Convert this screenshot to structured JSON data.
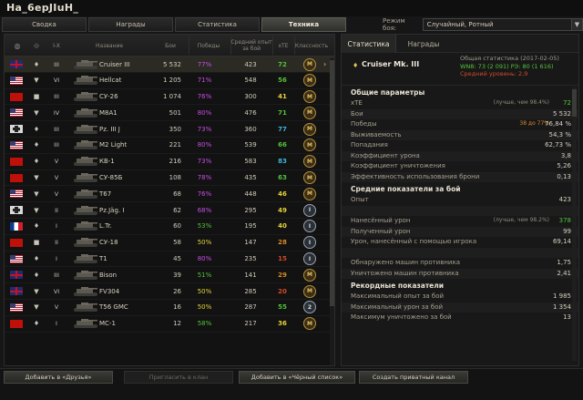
{
  "title": "Ha_6epJIuH_",
  "tabs": [
    {
      "label": "Сводка"
    },
    {
      "label": "Награды"
    },
    {
      "label": "Статистика"
    },
    {
      "label": "Техника"
    }
  ],
  "mode": {
    "label": "Режим боя:",
    "value": "Случайный, Ротный"
  },
  "columns": {
    "nation": "",
    "class": "",
    "tier": "I-X",
    "name": "Название",
    "battles": "Бои",
    "wins": "Победы",
    "avg_exp": "Средний опыт за бой",
    "xte": "xTE",
    "mastery": "Классность"
  },
  "vehicles": [
    {
      "nation": "gb",
      "class": "♦",
      "tier": "III",
      "name": "Cruiser III",
      "battles": "5 532",
      "wins": "77%",
      "win_color": "#c84ee8",
      "exp": "423",
      "xte": "72",
      "xte_color": "#53c23a",
      "mastery": "M",
      "mastery_color": "#e3c267"
    },
    {
      "nation": "us",
      "class": "▼",
      "tier": "VI",
      "name": "Hellcat",
      "battles": "1 205",
      "wins": "71%",
      "win_color": "#c84ee8",
      "exp": "548",
      "xte": "56",
      "xte_color": "#53c23a",
      "mastery": "M",
      "mastery_color": "#e3c267"
    },
    {
      "nation": "su",
      "class": "■",
      "tier": "III",
      "name": "СУ-26",
      "battles": "1 074",
      "wins": "76%",
      "win_color": "#c84ee8",
      "exp": "300",
      "xte": "41",
      "xte_color": "#e6d43a",
      "mastery": "M",
      "mastery_color": "#e3c267"
    },
    {
      "nation": "us",
      "class": "▼",
      "tier": "IV",
      "name": "M8A1",
      "battles": "501",
      "wins": "80%",
      "win_color": "#c84ee8",
      "exp": "476",
      "xte": "71",
      "xte_color": "#53c23a",
      "mastery": "M",
      "mastery_color": "#e3c267"
    },
    {
      "nation": "de",
      "class": "♦",
      "tier": "III",
      "name": "Pz. III J",
      "battles": "350",
      "wins": "73%",
      "win_color": "#c84ee8",
      "exp": "360",
      "xte": "77",
      "xte_color": "#3fb7d8",
      "mastery": "M",
      "mastery_color": "#e3c267"
    },
    {
      "nation": "us",
      "class": "♦",
      "tier": "III",
      "name": "M2 Light",
      "battles": "221",
      "wins": "80%",
      "win_color": "#c84ee8",
      "exp": "539",
      "xte": "66",
      "xte_color": "#53c23a",
      "mastery": "M",
      "mastery_color": "#e3c267"
    },
    {
      "nation": "su",
      "class": "♦",
      "tier": "V",
      "name": "КВ-1",
      "battles": "216",
      "wins": "73%",
      "win_color": "#c84ee8",
      "exp": "583",
      "xte": "83",
      "xte_color": "#3fb7d8",
      "mastery": "M",
      "mastery_color": "#e3c267"
    },
    {
      "nation": "su",
      "class": "▼",
      "tier": "V",
      "name": "СУ-85Б",
      "battles": "108",
      "wins": "78%",
      "win_color": "#c84ee8",
      "exp": "435",
      "xte": "63",
      "xte_color": "#53c23a",
      "mastery": "M",
      "mastery_color": "#e3c267"
    },
    {
      "nation": "us",
      "class": "▼",
      "tier": "V",
      "name": "T67",
      "battles": "68",
      "wins": "76%",
      "win_color": "#c84ee8",
      "exp": "448",
      "xte": "46",
      "xte_color": "#e6d43a",
      "mastery": "M",
      "mastery_color": "#e3c267"
    },
    {
      "nation": "de",
      "class": "▼",
      "tier": "II",
      "name": "Pz.Jäg. I",
      "battles": "62",
      "wins": "68%",
      "win_color": "#c84ee8",
      "exp": "295",
      "xte": "49",
      "xte_color": "#e6d43a",
      "mastery": "I",
      "mastery_color": "#d7dde5"
    },
    {
      "nation": "fr",
      "class": "♦",
      "tier": "I",
      "name": "L.Tr.",
      "battles": "60",
      "wins": "53%",
      "win_color": "#53c23a",
      "exp": "195",
      "xte": "40",
      "xte_color": "#e6d43a",
      "mastery": "I",
      "mastery_color": "#d7dde5"
    },
    {
      "nation": "su",
      "class": "■",
      "tier": "II",
      "name": "СУ-18",
      "battles": "58",
      "wins": "50%",
      "win_color": "#e6d43a",
      "exp": "147",
      "xte": "28",
      "xte_color": "#d68a2a",
      "mastery": "I",
      "mastery_color": "#d7dde5"
    },
    {
      "nation": "us",
      "class": "♦",
      "tier": "I",
      "name": "T1",
      "battles": "45",
      "wins": "80%",
      "win_color": "#c84ee8",
      "exp": "235",
      "xte": "15",
      "xte_color": "#d04a2a",
      "mastery": "I",
      "mastery_color": "#d7dde5"
    },
    {
      "nation": "gb",
      "class": "♦",
      "tier": "III",
      "name": "Bison",
      "battles": "39",
      "wins": "51%",
      "win_color": "#53c23a",
      "exp": "141",
      "xte": "29",
      "xte_color": "#d68a2a",
      "mastery": "M",
      "mastery_color": "#e3c267"
    },
    {
      "nation": "gb",
      "class": "▼",
      "tier": "VI",
      "name": "FV304",
      "battles": "26",
      "wins": "50%",
      "win_color": "#e6d43a",
      "exp": "285",
      "xte": "20",
      "xte_color": "#d04a2a",
      "mastery": "M",
      "mastery_color": "#e3c267"
    },
    {
      "nation": "us",
      "class": "▼",
      "tier": "V",
      "name": "T56 GMC",
      "battles": "16",
      "wins": "50%",
      "win_color": "#e6d43a",
      "exp": "287",
      "xte": "55",
      "xte_color": "#53c23a",
      "mastery": "2",
      "mastery_color": "#d7dde5"
    },
    {
      "nation": "su",
      "class": "♦",
      "tier": "I",
      "name": "МС-1",
      "battles": "12",
      "wins": "58%",
      "win_color": "#53c23a",
      "exp": "217",
      "xte": "36",
      "xte_color": "#e6d43a",
      "mastery": "M",
      "mastery_color": "#e3c267"
    }
  ],
  "detail": {
    "tabs": [
      {
        "label": "Статистика"
      },
      {
        "label": "Награды"
      }
    ],
    "vehicle_name": "Cruiser Mk. III",
    "info_line1": "Общая статистика (2017-02-05)",
    "info_line2": "WN8: 73 (2 091) РЭ: 80 (1 616)",
    "info_line3": "Средний уровень: 2,9",
    "sections": [
      {
        "title": "Общие параметры",
        "rows": [
          {
            "k": "xTE",
            "note": "(лучше, чем 98.4%)",
            "v": "72",
            "v_color": "#53c23a"
          },
          {
            "k": "Бои",
            "note": "",
            "v": "5 532",
            "v_color": "#d4cebe"
          },
          {
            "k": "Победы",
            "note": "38 до 77%",
            "v": "76,84 %",
            "v_color": "#d4cebe"
          },
          {
            "k": "Выживаемость",
            "note": "",
            "v": "54,3 %",
            "v_color": "#d4cebe"
          },
          {
            "k": "Попадания",
            "note": "",
            "v": "62,73 %",
            "v_color": "#d4cebe"
          },
          {
            "k": "Коэффициент урона",
            "note": "",
            "v": "3,8",
            "v_color": "#d4cebe"
          },
          {
            "k": "Коэффициент уничтожения",
            "note": "",
            "v": "5,26",
            "v_color": "#d4cebe"
          },
          {
            "k": "Эффективность использования брони",
            "note": "",
            "v": "0,13",
            "v_color": "#d4cebe"
          }
        ]
      },
      {
        "title": "Средние показатели за бой",
        "rows": [
          {
            "k": "Опыт",
            "note": "",
            "v": "423",
            "v_color": "#d4cebe"
          },
          {
            "k": "",
            "note": "",
            "v": "",
            "v_color": "#d4cebe"
          },
          {
            "k": "Нанесённый урон",
            "note": "(лучше, чем 98.2%)",
            "v": "378",
            "v_color": "#53c23a"
          },
          {
            "k": "Полученный урон",
            "note": "",
            "v": "99",
            "v_color": "#d4cebe"
          },
          {
            "k": "Урон, нанесённый с помощью игрока",
            "note": "",
            "v": "69,14",
            "v_color": "#d4cebe"
          },
          {
            "k": "",
            "note": "",
            "v": "",
            "v_color": "#d4cebe"
          },
          {
            "k": "Обнаружено машин противника",
            "note": "",
            "v": "1,75",
            "v_color": "#d4cebe"
          },
          {
            "k": "Уничтожено машин противника",
            "note": "",
            "v": "2,41",
            "v_color": "#d4cebe"
          }
        ]
      },
      {
        "title": "Рекордные показатели",
        "rows": [
          {
            "k": "Максимальный опыт за бой",
            "note": "",
            "v": "1 985",
            "v_color": "#d4cebe"
          },
          {
            "k": "Максимальный урон за бой",
            "note": "",
            "v": "1 354",
            "v_color": "#d4cebe"
          },
          {
            "k": "Максимум уничтожено за бой",
            "note": "",
            "v": "13",
            "v_color": "#d4cebe"
          }
        ]
      }
    ]
  },
  "buttons": {
    "add_friend": "Добавить в «Друзья»",
    "invite_clan": "Пригласить в клан",
    "add_blacklist": "Добавить в «Чёрный список»",
    "private_channel": "Создать приватный канал"
  }
}
